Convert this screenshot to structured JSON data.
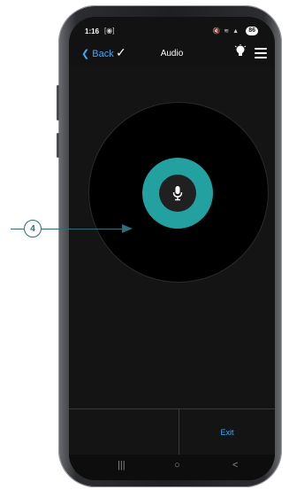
{
  "status_bar": {
    "time": "1:16",
    "battery": "86"
  },
  "nav": {
    "back_label": "Back",
    "title": "Audio"
  },
  "footer": {
    "exit_label": "Exit"
  },
  "callout": {
    "number": "4"
  },
  "colors": {
    "accent_teal": "#23a1a1",
    "link_blue": "#3fa9f5",
    "callout": "#2f6d77"
  },
  "icons": [
    "screen-record-icon",
    "mute-icon",
    "wifi-icon",
    "signal-icon",
    "checkmark-icon",
    "lightbulb-icon",
    "hamburger-menu-icon",
    "microphone-icon",
    "recents-icon",
    "home-icon",
    "back-nav-icon"
  ]
}
